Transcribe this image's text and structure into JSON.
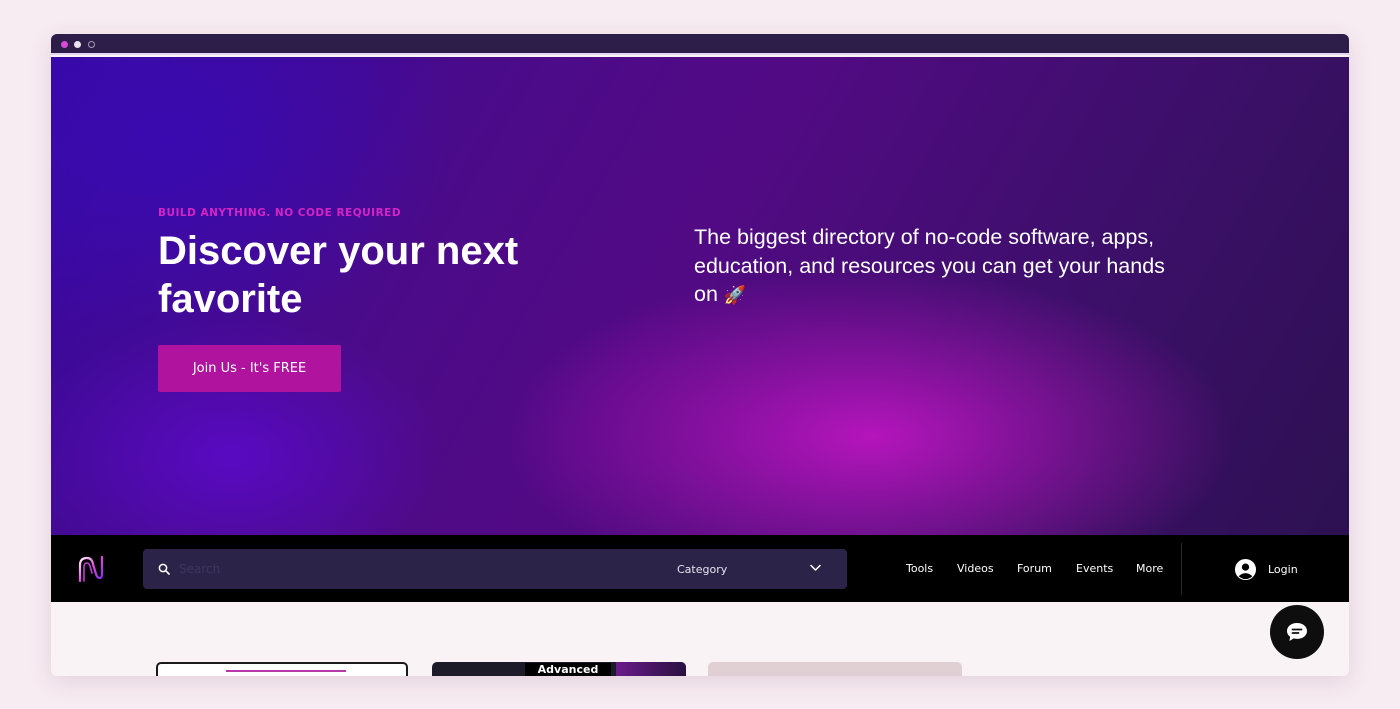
{
  "hero": {
    "eyebrow": "BUILD ANYTHING. NO CODE REQUIRED",
    "headline": "Discover your next favorite",
    "cta_label": "Join Us - It's FREE",
    "tagline": "The biggest directory of no-code software, apps, education, and resources you can get your hands on",
    "tagline_icon": "rocket-icon"
  },
  "navbar": {
    "search": {
      "placeholder": "Search",
      "value": ""
    },
    "category": {
      "selected": "Category"
    },
    "links": [
      "Tools",
      "Videos",
      "Forum",
      "Events",
      "More"
    ],
    "login_label": "Login"
  },
  "content": {
    "card_label": "Advanced"
  },
  "colors": {
    "accent": "#b0149f",
    "eyebrow": "#d424c6",
    "nav_background": "#000000",
    "search_background": "#2b2448"
  }
}
